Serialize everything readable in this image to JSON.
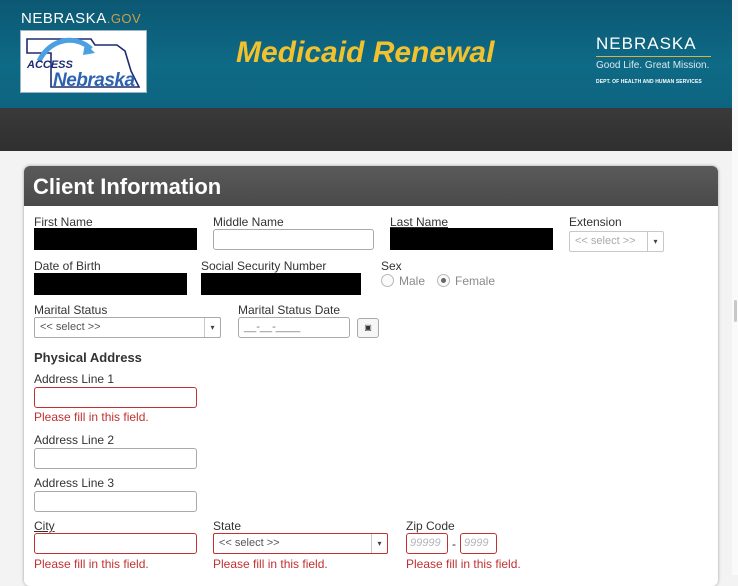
{
  "header": {
    "nebraska_gov_prefix": "NEBRASKA",
    "nebraska_gov_suffix": ".GOV",
    "logo_access": "ACCESS",
    "logo_nebraska": "Nebraska",
    "app_title": "Medicaid Renewal",
    "brand_name": "NEBRASKA",
    "brand_tagline": "Good Life. Great Mission.",
    "brand_dept": "DEPT. OF HEALTH AND HUMAN SERVICES"
  },
  "client_info": {
    "title": "Client Information",
    "first_name_label": "First Name",
    "middle_name_label": "Middle Name",
    "last_name_label": "Last Name",
    "extension_label": "Extension",
    "extension_value": "<< select >>",
    "dob_label": "Date of Birth",
    "ssn_label": "Social Security Number",
    "sex_label": "Sex",
    "sex_options": [
      "Male",
      "Female"
    ],
    "sex_selected": "Female",
    "marital_status_label": "Marital Status",
    "marital_status_value": "<< select >>",
    "marital_status_date_label": "Marital Status Date",
    "marital_status_date_placeholder": "__-__-____"
  },
  "physical_address": {
    "title": "Physical Address",
    "address_line1_label": "Address Line 1",
    "address_line1_error": "Please fill in this field.",
    "address_line2_label": "Address Line 2",
    "address_line3_label": "Address Line 3",
    "city_label": "City",
    "city_error": "Please fill in this field.",
    "state_label": "State",
    "state_value": "<< select >>",
    "state_error": "Please fill in this field.",
    "zip_label": "Zip Code",
    "zip_placeholder": "99999",
    "zip_ext_placeholder": "9999",
    "zip_error": "Please fill in this field."
  },
  "colors": {
    "banner": "#0e6a86",
    "title_gold": "#f1c22d",
    "error_red": "#c13131",
    "panel_header": "#4a4a4a"
  }
}
